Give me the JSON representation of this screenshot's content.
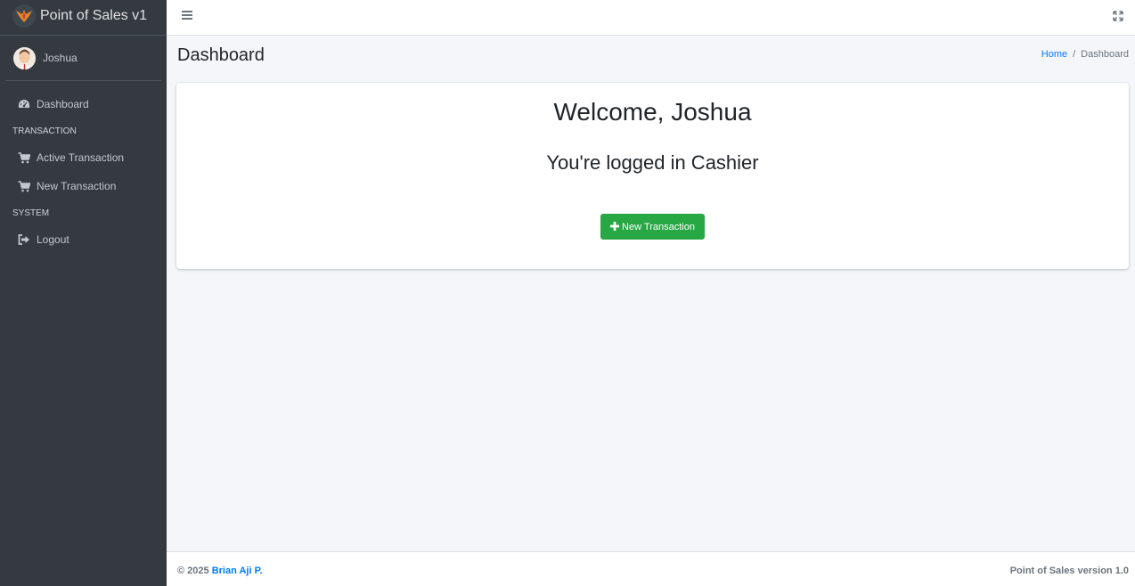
{
  "app": {
    "brand": "Point of Sales v1"
  },
  "user": {
    "name": "Joshua"
  },
  "sidebar": {
    "items": [
      {
        "type": "item",
        "label": "Dashboard",
        "icon": "dashboard-icon"
      },
      {
        "type": "header",
        "label": "TRANSACTION"
      },
      {
        "type": "item",
        "label": "Active Transaction",
        "icon": "cart-icon"
      },
      {
        "type": "item",
        "label": "New Transaction",
        "icon": "cart-icon"
      },
      {
        "type": "header",
        "label": "SYSTEM"
      },
      {
        "type": "item",
        "label": "Logout",
        "icon": "logout-icon"
      }
    ]
  },
  "header": {
    "title": "Dashboard",
    "breadcrumb": {
      "home": "Home",
      "separator": "/",
      "current": "Dashboard"
    }
  },
  "main": {
    "welcome": "Welcome, Joshua",
    "role_text": "You're logged in Cashier",
    "new_button": {
      "label": "New Transaction",
      "icon": "plus-icon"
    }
  },
  "footer": {
    "copyright": "© 2025",
    "author": "Brian Aji P.",
    "version": "Point of Sales version 1.0"
  },
  "colors": {
    "sidebar_bg": "#343a40",
    "accent": "#007bff",
    "success": "#28a745",
    "content_bg": "#f4f6f9"
  }
}
